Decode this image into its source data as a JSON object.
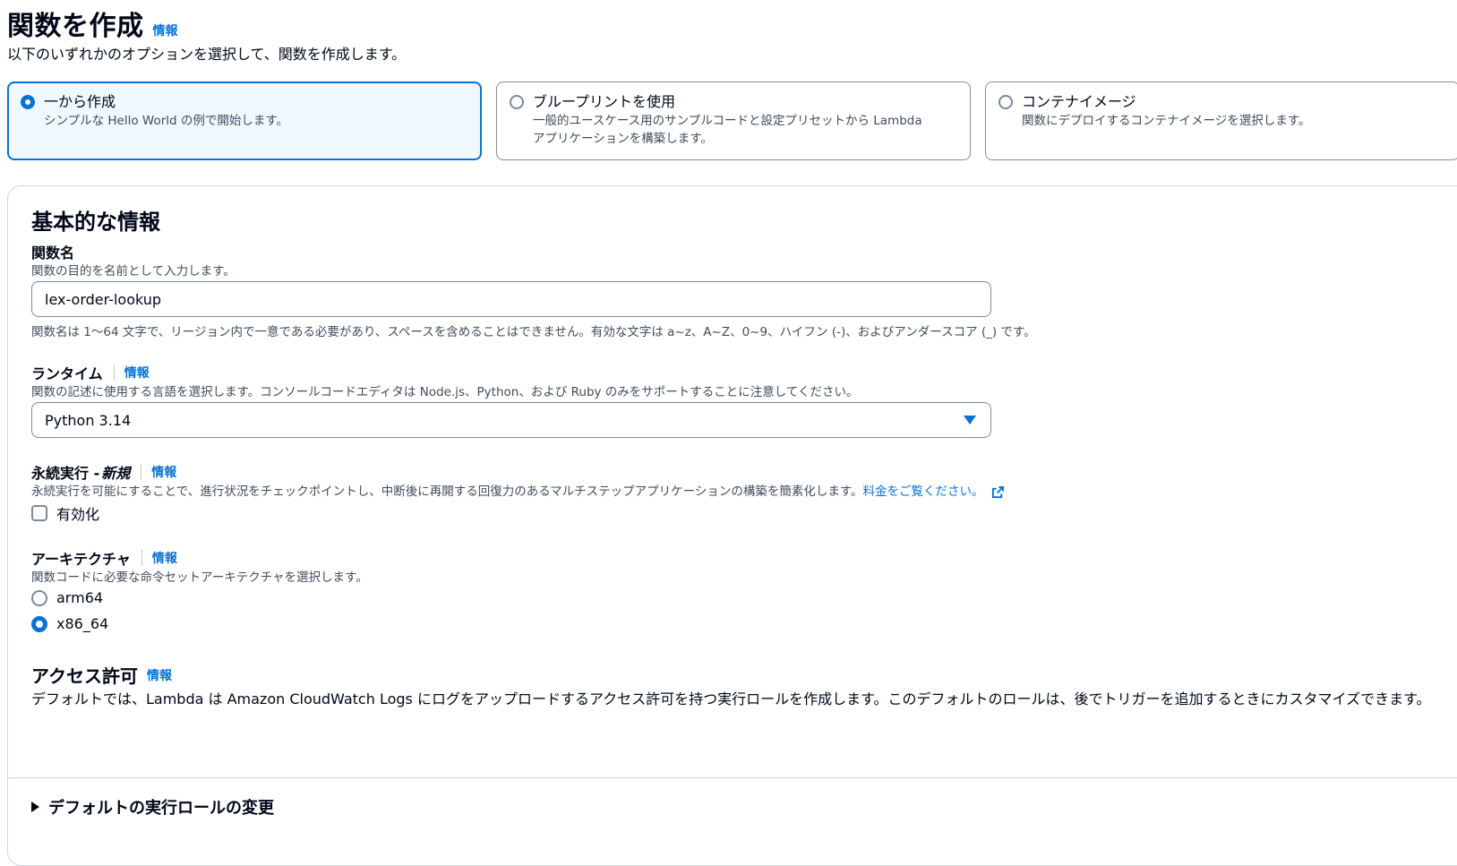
{
  "header": {
    "title": "関数を作成",
    "info": "情報",
    "description": "以下のいずれかのオプションを選択して、関数を作成します。"
  },
  "options": [
    {
      "title": "一から作成",
      "description": "シンプルな Hello World の例で開始します。",
      "selected": true
    },
    {
      "title": "ブループリントを使用",
      "description": "一般的ユースケース用のサンプルコードと設定プリセットから Lambda アプリケーションを構築します。",
      "selected": false
    },
    {
      "title": "コンテナイメージ",
      "description": "関数にデプロイするコンテナイメージを選択します。",
      "selected": false
    }
  ],
  "basic": {
    "heading": "基本的な情報",
    "function_name": {
      "label": "関数名",
      "description": "関数の目的を名前として入力します。",
      "value": "lex-order-lookup",
      "constraint": "関数名は 1〜64 文字で、リージョン内で一意である必要があり、スペースを含めることはできません。有効な文字は a~z、A~Z、0~9、ハイフン (-)、およびアンダースコア (_) です。"
    },
    "runtime": {
      "label": "ランタイム",
      "info": "情報",
      "description": "関数の記述に使用する言語を選択します。コンソールコードエディタは Node.js、Python、および Ruby のみをサポートすることに注意してください。",
      "value": "Python 3.14"
    },
    "durable": {
      "label": "永続実行 - ",
      "label_new": "新規",
      "info": "情報",
      "description": "永続実行を可能にすることで、進行状況をチェックポイントし、中断後に再開する回復力のあるマルチステップアプリケーションの構築を簡素化します。",
      "link": "料金をご覧ください。",
      "checkbox_label": "有効化",
      "checked": false
    },
    "architecture": {
      "label": "アーキテクチャ",
      "info": "情報",
      "description": "関数コードに必要な命令セットアーキテクチャを選択します。",
      "options": [
        "arm64",
        "x86_64"
      ],
      "selected": "x86_64"
    },
    "permissions": {
      "heading": "アクセス許可",
      "info": "情報",
      "text": "デフォルトでは、Lambda は Amazon CloudWatch Logs にログをアップロードするアクセス許可を持つ実行ロールを作成します。このデフォルトのロールは、後でトリガーを追加するときにカスタマイズできます。"
    },
    "expand_label": "デフォルトの実行ロールの変更"
  },
  "colors": {
    "accent": "#0972d3",
    "text": "#000716",
    "muted": "#414d5c"
  }
}
